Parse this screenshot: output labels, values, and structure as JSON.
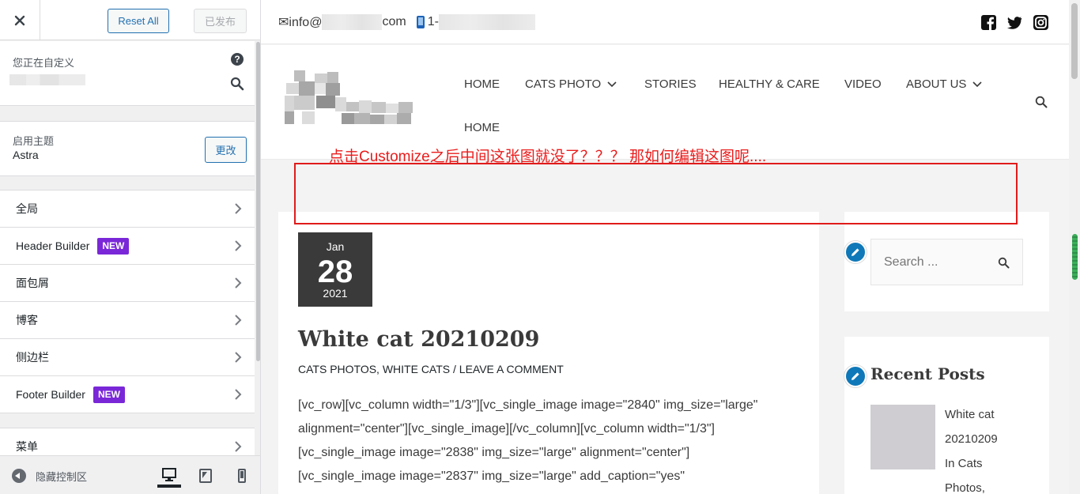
{
  "customizer": {
    "reset_label": "Reset All",
    "publish_label": "已发布",
    "customizing_label": "您正在自定义",
    "active_theme_label": "启用主题",
    "active_theme_name": "Astra",
    "change_label": "更改",
    "sections": [
      {
        "label": "全局"
      },
      {
        "label": "Header Builder",
        "badge": "NEW"
      },
      {
        "label": "面包屑"
      },
      {
        "label": "博客"
      },
      {
        "label": "侧边栏"
      },
      {
        "label": "Footer Builder",
        "badge": "NEW"
      }
    ],
    "menus_label": "菜单",
    "hide_controls_label": "隐藏控制区",
    "devices": [
      "desktop",
      "tablet",
      "mobile"
    ],
    "active_device": "desktop",
    "badge_color": "#7a27d8",
    "accent_color": "#2271b1"
  },
  "site": {
    "email_prefix": "✉info@",
    "email_suffix": "com",
    "phone_prefix": "1-",
    "social_icons": [
      "facebook-icon",
      "twitter-icon",
      "instagram-icon"
    ],
    "nav": [
      {
        "label": "HOME"
      },
      {
        "label": "CATS PHOTO",
        "dropdown": true
      },
      {
        "label": "STORIES"
      },
      {
        "label": "HEALTHY & CARE"
      },
      {
        "label": "VIDEO"
      },
      {
        "label": "ABOUT US",
        "dropdown": true
      },
      {
        "label": "HOME"
      }
    ]
  },
  "annotation": {
    "text": "点击Customize之后中间这张图就没了？？？ 那如何编辑这图呢....",
    "color": "#ea1c1c"
  },
  "post": {
    "month": "Jan",
    "day": "28",
    "year": "2021",
    "title": "White cat 20210209",
    "meta": "CATS PHOTOS, WHITE CATS / LEAVE A COMMENT",
    "body_lines": [
      "[vc_row][vc_column width=\"1/3\"][vc_single_image image=\"2840\" img_size=\"large\"",
      "alignment=\"center\"][vc_single_image][/vc_column][vc_column width=\"1/3\"]",
      "[vc_single_image image=\"2838\" img_size=\"large\" alignment=\"center\"]",
      "[vc_single_image image=\"2837\" img_size=\"large\" add_caption=\"yes\""
    ]
  },
  "widgets": {
    "search_placeholder": "Search ...",
    "recent_posts_title": "Recent Posts",
    "recent_post_lines": [
      "White cat",
      "20210209",
      "In Cats",
      "Photos,"
    ]
  }
}
